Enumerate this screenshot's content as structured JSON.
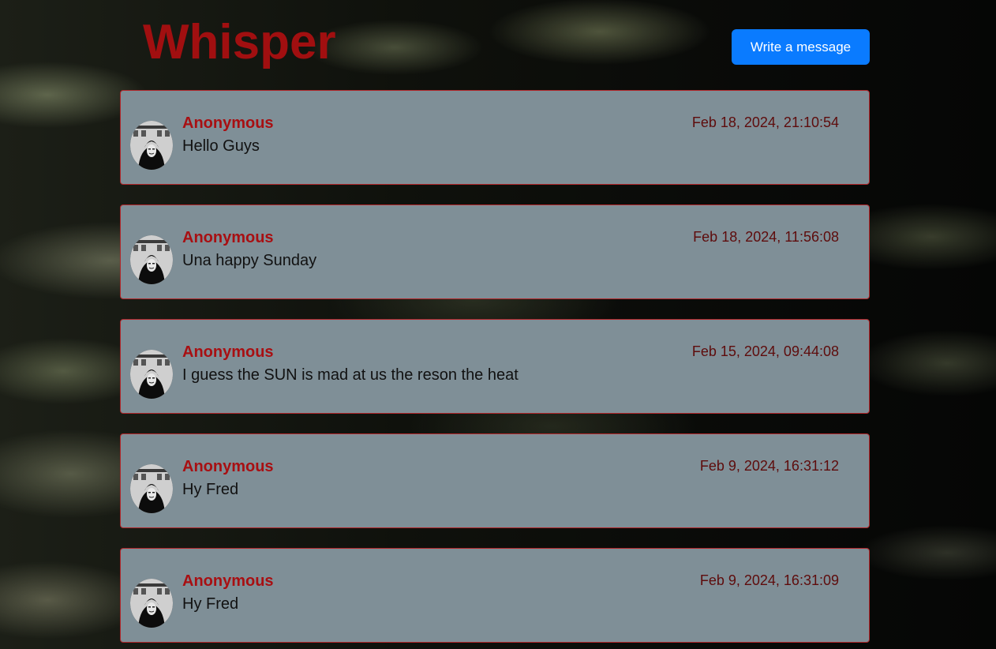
{
  "app": {
    "title": "Whisper",
    "write_button_label": "Write a message",
    "accent_color": "#a10f10",
    "button_color": "#0a7bff",
    "card_color": "#7f8f97"
  },
  "messages": [
    {
      "author": "Anonymous",
      "text": "Hello Guys",
      "timestamp": "Feb 18, 2024, 21:10:54",
      "avatar_icon": "anonymous-mask-avatar"
    },
    {
      "author": "Anonymous",
      "text": "Una happy Sunday",
      "timestamp": "Feb 18, 2024, 11:56:08",
      "avatar_icon": "anonymous-mask-avatar"
    },
    {
      "author": "Anonymous",
      "text": "I guess the SUN is mad at us the reson the heat",
      "timestamp": "Feb 15, 2024, 09:44:08",
      "avatar_icon": "anonymous-mask-avatar"
    },
    {
      "author": "Anonymous",
      "text": "Hy Fred",
      "timestamp": "Feb 9, 2024, 16:31:12",
      "avatar_icon": "anonymous-mask-avatar"
    },
    {
      "author": "Anonymous",
      "text": "Hy Fred",
      "timestamp": "Feb 9, 2024, 16:31:09",
      "avatar_icon": "anonymous-mask-avatar"
    }
  ]
}
